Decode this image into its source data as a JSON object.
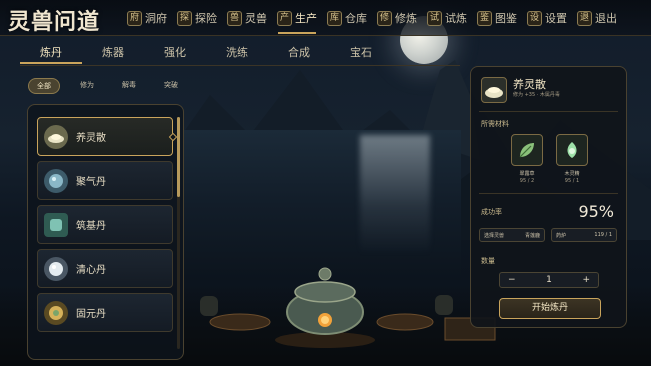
{
  "app": {
    "logo": "灵兽问道"
  },
  "nav": [
    {
      "label": "洞府",
      "glyph": "府",
      "active": false
    },
    {
      "label": "探险",
      "glyph": "探",
      "active": false
    },
    {
      "label": "灵兽",
      "glyph": "兽",
      "active": false
    },
    {
      "label": "生产",
      "glyph": "产",
      "active": true
    },
    {
      "label": "仓库",
      "glyph": "库",
      "active": false
    },
    {
      "label": "修炼",
      "glyph": "修",
      "active": false
    },
    {
      "label": "试炼",
      "glyph": "试",
      "active": false
    },
    {
      "label": "图鉴",
      "glyph": "鉴",
      "active": false
    },
    {
      "label": "设置",
      "glyph": "设",
      "active": false
    },
    {
      "label": "退出",
      "glyph": "退",
      "active": false
    }
  ],
  "tabs": [
    {
      "label": "炼丹",
      "active": true
    },
    {
      "label": "炼器",
      "active": false
    },
    {
      "label": "强化",
      "active": false
    },
    {
      "label": "洗练",
      "active": false
    },
    {
      "label": "合成",
      "active": false
    },
    {
      "label": "宝石",
      "active": false
    }
  ],
  "subtabs": [
    {
      "label": "全部",
      "active": true
    },
    {
      "label": "修为",
      "active": false
    },
    {
      "label": "解毒",
      "active": false
    },
    {
      "label": "突破",
      "active": false
    }
  ],
  "recipes": [
    {
      "label": "养灵散",
      "selected": true,
      "color": "#c9c79a"
    },
    {
      "label": "聚气丹",
      "selected": false,
      "color": "#8ab7c7"
    },
    {
      "label": "筑基丹",
      "selected": false,
      "color": "#7fc2b3"
    },
    {
      "label": "清心丹",
      "selected": false,
      "color": "#e5ecf0"
    },
    {
      "label": "固元丹",
      "selected": false,
      "color": "#d6b25a"
    }
  ],
  "detail": {
    "name": "养灵散",
    "subtitle": "修为 +35 · 木属丹毒",
    "materials_title": "所需材料",
    "materials": [
      {
        "label": "翠露草",
        "count": "95 / 2",
        "icon": "leaf-icon"
      },
      {
        "label": "木灵精",
        "count": "95 / 1",
        "icon": "wood-spirit-icon"
      }
    ],
    "rate_label": "成功率",
    "rate_value": "95%",
    "slot_left_label": "选择灵兽",
    "slot_left_value": "青莲鹿",
    "slot_right_label": "药炉",
    "slot_right_value": "119 / 1",
    "quantity_label": "数量",
    "quantity_value": "1",
    "minus_label": "−",
    "plus_label": "+",
    "start_button": "开始炼丹"
  }
}
